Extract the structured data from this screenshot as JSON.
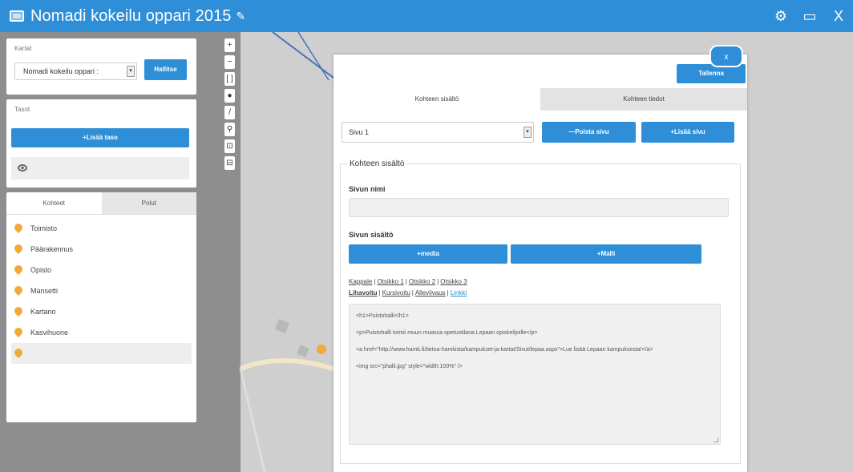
{
  "header": {
    "title": "Nomadi kokeilu oppari 2015",
    "edit_icon": "pencil-icon",
    "icons": [
      "gear-icon",
      "folder-icon",
      "close-icon"
    ],
    "close_label": "X"
  },
  "sidebar": {
    "maps": {
      "title": "Kartat",
      "selected": "Nomadi kokeilu oppari :",
      "manage_label": "Hallitse"
    },
    "layers": {
      "title": "Tasot",
      "add_label": "+Lisää taso"
    },
    "objects": {
      "tabs": [
        "Kohteet",
        "Polut"
      ],
      "items": [
        "Toimisto",
        "Päärakennus",
        "Opisto",
        "Mansetti",
        "Kartano",
        "Kasvihuone",
        ""
      ]
    }
  },
  "map_tools": [
    "+",
    "−",
    "[ ]",
    "●",
    "/",
    "⚲",
    "⊡",
    "⊟"
  ],
  "dialog": {
    "save_label": "Tallenna",
    "close_label": "x",
    "tabs": [
      "Kohteen sisältö",
      "Kohteen tiedot"
    ],
    "page_select": "Sivu 1",
    "delete_page_label": "—Poista sivu",
    "add_page_label": "+Lisää sivu",
    "section_title": "Kohteen sisältö",
    "page_name_label": "Sivun nimi",
    "page_content_label": "Sivun sisältö",
    "media_label": "+media",
    "model_label": "+Malli",
    "format_line1": [
      "Kappale",
      "Otsikko 1",
      "Otsikko 2",
      "Otsikko 3"
    ],
    "format_line2": [
      "Lihavoitu",
      "Kursivoitu",
      "Alleviivaus",
      "Linkki"
    ],
    "code_lines": [
      "<h1>Puistohalli</h1>",
      "<p>Puistohalli toimii muun muassa opetustilana Lepaan opiskelijoille</p>",
      "<a href=\"http://www.hamk.fi/tietoa-hamkista/kampukset-ja-kartat/Sivut/lepaa.aspx\">Lue lisää Lepaan kampuksesta!</a>",
      "<img src=\"phalli.jpg\" style=\"width:100%\" />"
    ]
  }
}
